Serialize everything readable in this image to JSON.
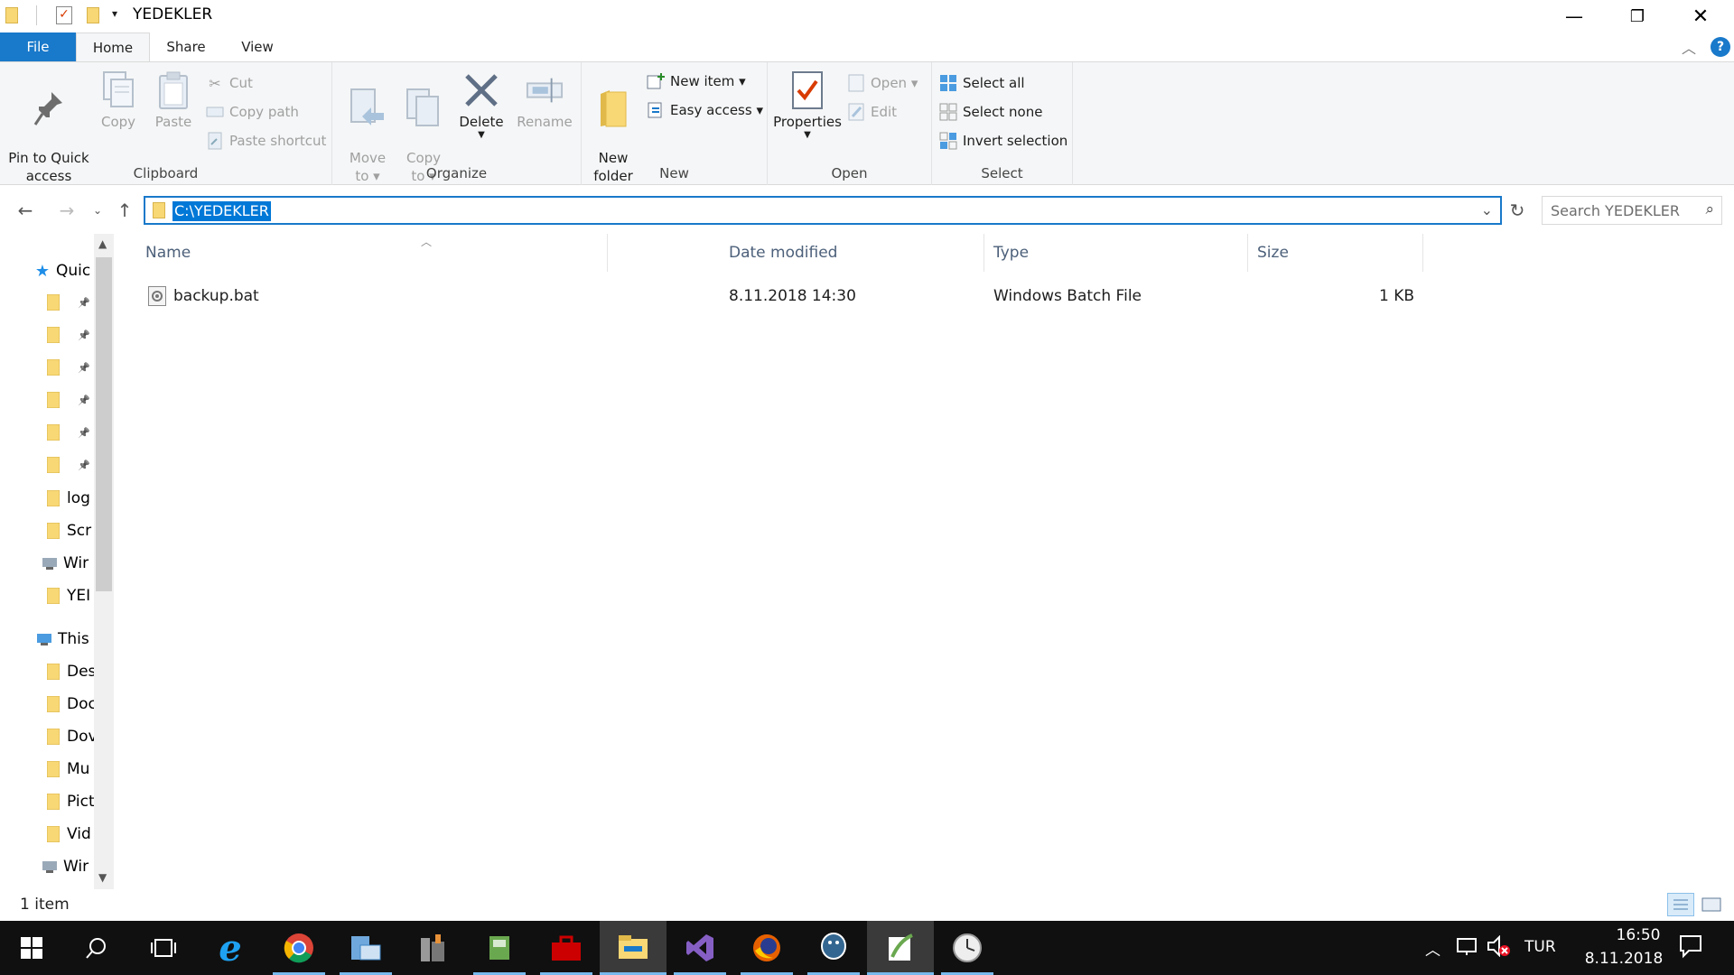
{
  "window": {
    "title": "YEDEKLER"
  },
  "ribbon_tabs": [
    "File",
    "Home",
    "Share",
    "View"
  ],
  "ribbon": {
    "clipboard": {
      "label": "Clipboard",
      "pin": "Pin to Quick\naccess",
      "copy": "Copy",
      "paste": "Paste",
      "cut": "Cut",
      "copy_path": "Copy path",
      "paste_shortcut": "Paste shortcut"
    },
    "organize": {
      "label": "Organize",
      "move_to": "Move\nto ▾",
      "copy_to": "Copy\nto ▾",
      "delete": "Delete",
      "rename": "Rename"
    },
    "new": {
      "label": "New",
      "new_folder": "New\nfolder",
      "new_item": "New item ▾",
      "easy_access": "Easy access ▾"
    },
    "open": {
      "label": "Open",
      "properties": "Properties",
      "open": "Open ▾",
      "edit": "Edit"
    },
    "select": {
      "label": "Select",
      "select_all": "Select all",
      "select_none": "Select none",
      "invert": "Invert selection"
    }
  },
  "address": {
    "path": "C:\\YEDEKLER",
    "search_placeholder": "Search YEDEKLER"
  },
  "nav_pane": {
    "items": [
      {
        "label": "Quic",
        "icon": "star-icon"
      },
      {
        "label": "",
        "icon": "folder-icon"
      },
      {
        "label": "",
        "icon": "folder-icon"
      },
      {
        "label": "",
        "icon": "desktop-folder-icon"
      },
      {
        "label": "",
        "icon": "download-folder-icon"
      },
      {
        "label": "",
        "icon": "document-folder-icon"
      },
      {
        "label": "",
        "icon": "picture-folder-icon"
      },
      {
        "label": "log",
        "icon": "folder-icon"
      },
      {
        "label": "Scr",
        "icon": "folder-icon"
      },
      {
        "label": "Wir",
        "icon": "drive-icon"
      },
      {
        "label": "YEI",
        "icon": "folder-icon"
      },
      {
        "label": "This",
        "icon": "computer-icon"
      },
      {
        "label": "Des",
        "icon": "desktop-folder-icon"
      },
      {
        "label": "Doc",
        "icon": "document-folder-icon"
      },
      {
        "label": "Dov",
        "icon": "download-folder-icon"
      },
      {
        "label": "Mu",
        "icon": "music-folder-icon"
      },
      {
        "label": "Pict",
        "icon": "picture-folder-icon"
      },
      {
        "label": "Vid",
        "icon": "video-folder-icon"
      },
      {
        "label": "Wir",
        "icon": "drive-icon"
      }
    ]
  },
  "columns": [
    "Name",
    "Date modified",
    "Type",
    "Size"
  ],
  "files": [
    {
      "name": "backup.bat",
      "date": "8.11.2018 14:30",
      "type": "Windows Batch File",
      "size": "1 KB"
    }
  ],
  "status": {
    "count": "1 item"
  },
  "tray": {
    "lang": "TUR",
    "time": "16:50",
    "date": "8.11.2018"
  },
  "colors": {
    "accent": "#1979ca",
    "selection": "#0078d7",
    "folder": "#f8d775",
    "taskbar": "#101010"
  }
}
